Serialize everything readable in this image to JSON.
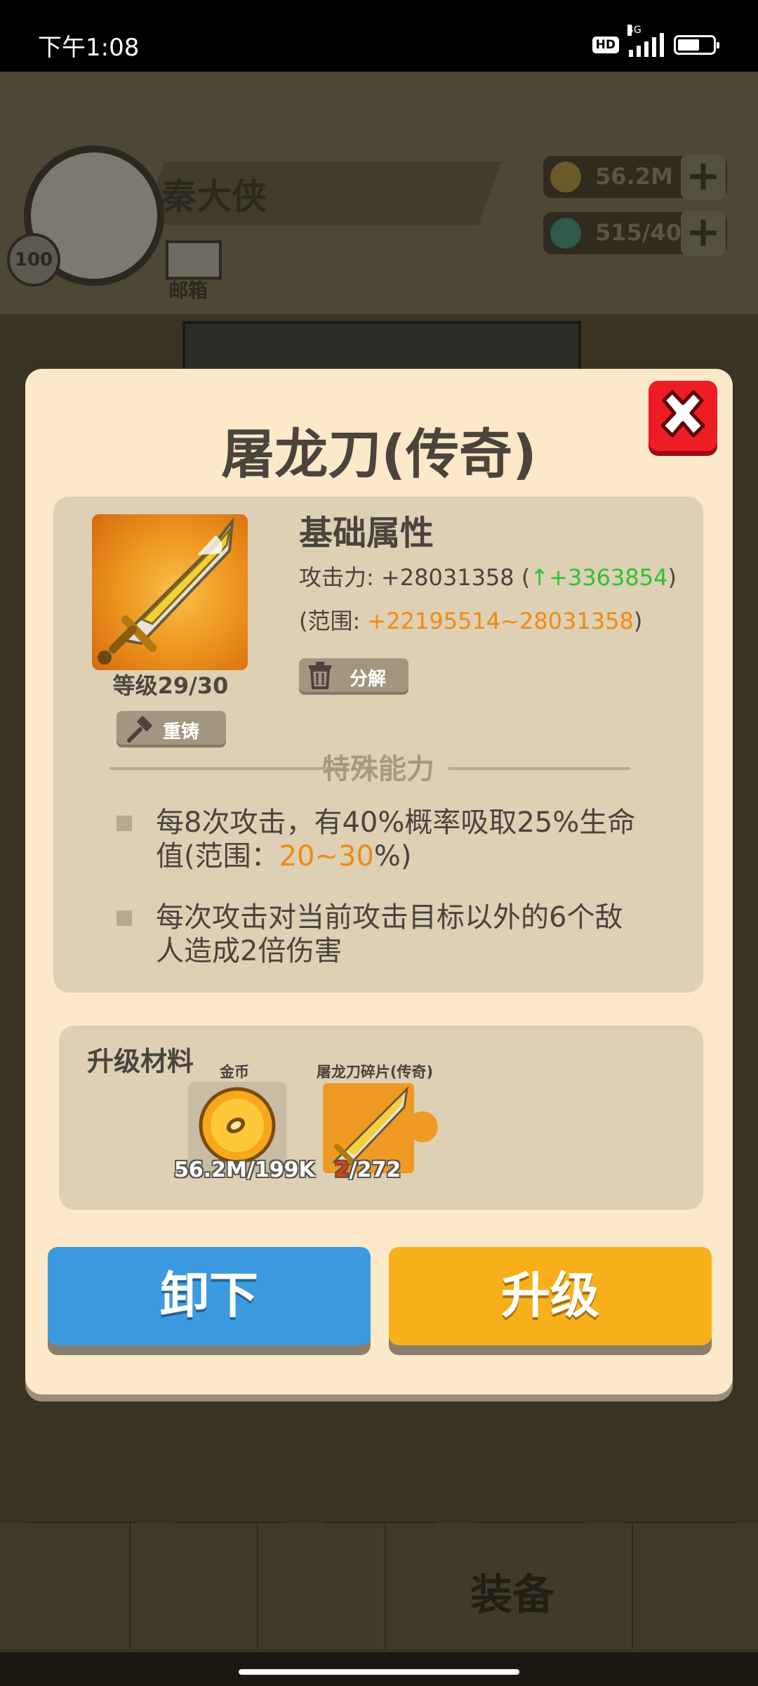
{
  "status_bar": {
    "time": "下午1:08",
    "hd_badge": "HD",
    "network": "4G"
  },
  "background": {
    "player_name": "秦大侠",
    "player_level": "100",
    "mailbox_label": "邮箱",
    "gold_amount": "56.2M",
    "gem_amount": "515/40",
    "plus_symbol": "+",
    "nav_equipment_label": "装备"
  },
  "dialog": {
    "title": "屠龙刀(传奇)",
    "item_level": "等级29/30",
    "reforge_label": "重铸",
    "disassemble_label": "分解",
    "basic_attr_title": "基础属性",
    "attack": {
      "label": "攻击力: +28031358 (",
      "increase": "↑+3363854",
      "close": ")"
    },
    "range": {
      "label": "(范围: ",
      "value": "+22195514~28031358",
      "close": ")"
    },
    "special_title": "特殊能力",
    "ability_1": {
      "pre": "每8次攻击，有40%概率吸取25%生命值(范围：",
      "range": "20~30",
      "post": "%)"
    },
    "ability_2": "每次攻击对当前攻击目标以外的6个敌人造成2倍伤害",
    "materials": {
      "title": "升级材料",
      "gold_label": "金币",
      "gold_count": "56.2M/199K",
      "shard_label": "屠龙刀碎片(传奇)",
      "shard_have": "2",
      "shard_need": "/272"
    },
    "unequip_label": "卸下",
    "upgrade_label": "升级"
  },
  "colors": {
    "accent_green": "#2ec22e",
    "accent_orange": "#f08a12",
    "close_red": "#ee1c25",
    "button_blue": "#3c9be0",
    "button_gold": "#f7b01b"
  }
}
